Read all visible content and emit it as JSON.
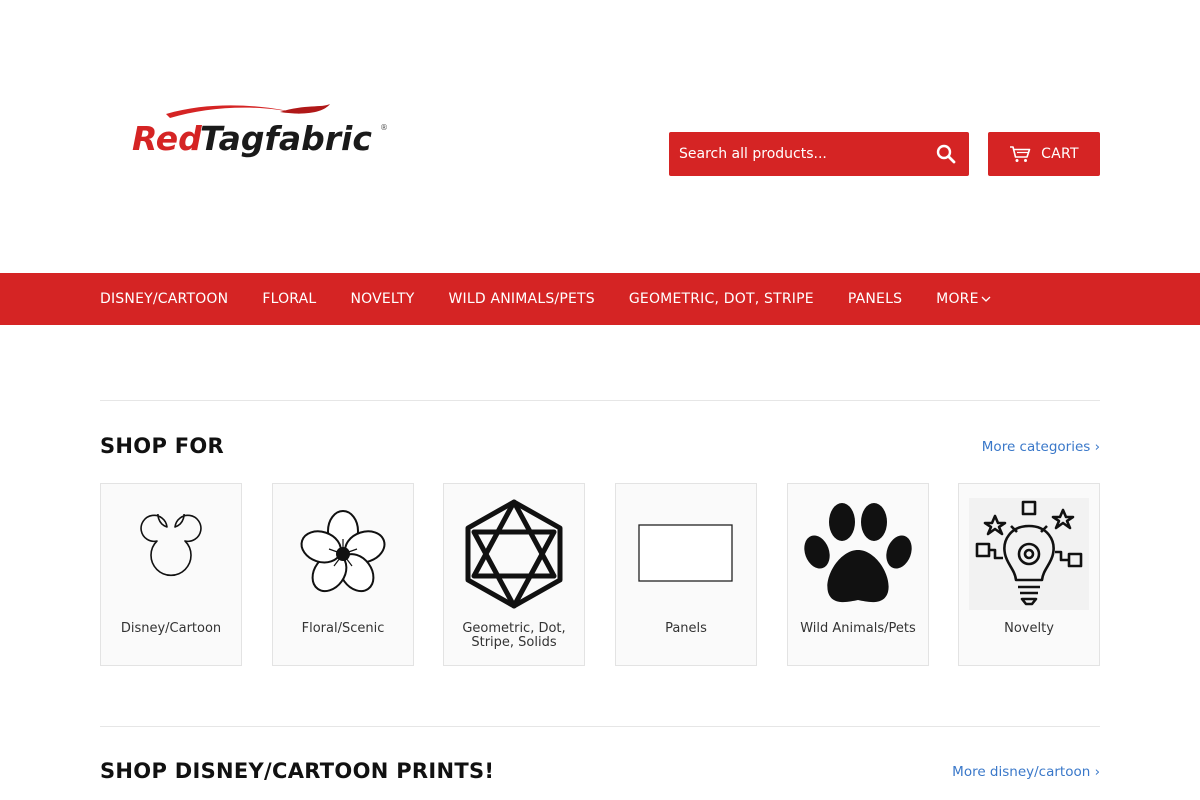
{
  "brand": {
    "logo_text": "RedTagfabric",
    "accent": "#d52424"
  },
  "search": {
    "placeholder": "Search all products...",
    "icon": "search-icon"
  },
  "cart": {
    "label": "CART",
    "icon": "cart-icon"
  },
  "nav": {
    "items": [
      {
        "label": "DISNEY/CARTOON"
      },
      {
        "label": "FLORAL"
      },
      {
        "label": "NOVELTY"
      },
      {
        "label": "WILD ANIMALS/PETS"
      },
      {
        "label": "GEOMETRIC, DOT, STRIPE"
      },
      {
        "label": "PANELS"
      },
      {
        "label": "MORE",
        "icon": "chevron-down-icon"
      }
    ]
  },
  "shop_for": {
    "title": "SHOP FOR",
    "more_link": "More categories ›",
    "categories": [
      {
        "label": "Disney/Cartoon",
        "icon": "mouse-ears-icon"
      },
      {
        "label": "Floral/Scenic",
        "icon": "flower-icon"
      },
      {
        "label": "Geometric, Dot, Stripe, Solids",
        "icon": "geometric-hexagon-icon"
      },
      {
        "label": "Panels",
        "icon": "rectangle-panel-icon"
      },
      {
        "label": "Wild Animals/Pets",
        "icon": "paw-print-icon"
      },
      {
        "label": "Novelty",
        "icon": "lightbulb-gear-icon"
      }
    ]
  },
  "disney_section": {
    "title": "SHOP DISNEY/CARTOON PRINTS!",
    "more_link": "More disney/cartoon ›"
  }
}
